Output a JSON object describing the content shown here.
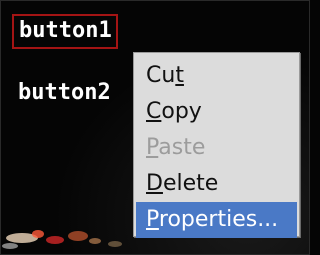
{
  "desktop": {
    "buttons": [
      {
        "label": "button1"
      },
      {
        "label": "button2"
      }
    ]
  },
  "context_menu": {
    "items": [
      {
        "pre": "Cu",
        "mn": "t",
        "post": "",
        "enabled": true,
        "selected": false
      },
      {
        "pre": "",
        "mn": "C",
        "post": "opy",
        "enabled": true,
        "selected": false
      },
      {
        "pre": "",
        "mn": "P",
        "post": "aste",
        "enabled": false,
        "selected": false
      },
      {
        "pre": "",
        "mn": "D",
        "post": "elete",
        "enabled": true,
        "selected": false
      },
      {
        "pre": "",
        "mn": "P",
        "post": "roperties...",
        "enabled": true,
        "selected": true
      }
    ]
  },
  "colors": {
    "focus_border": "#a41414",
    "menu_bg": "#dcdcdc",
    "selection_bg": "#4a79c6",
    "disabled_text": "#9c9c9c"
  }
}
